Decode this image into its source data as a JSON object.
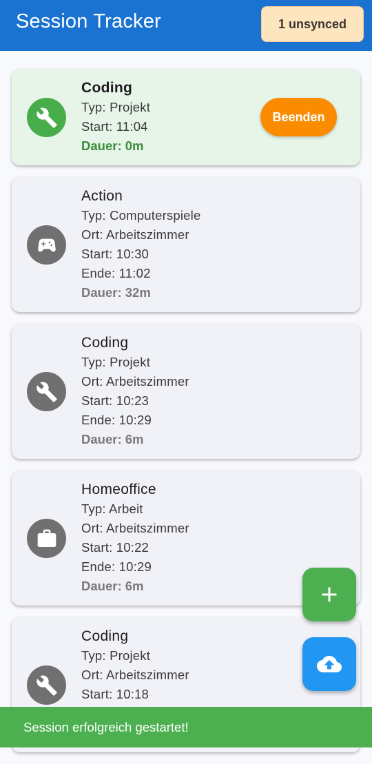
{
  "appbar": {
    "title": "Session Tracker",
    "unsynced_label": "1 unsynced"
  },
  "active_session": {
    "title": "Coding",
    "type": "Typ: Projekt",
    "start": "Start: 11:04",
    "duration": "Dauer: 0m",
    "end_button": "Beenden",
    "icon": "wrench-icon"
  },
  "sessions": [
    {
      "title": "Action",
      "type": "Typ: Computerspiele",
      "location": "Ort: Arbeitszimmer",
      "start": "Start: 10:30",
      "end": "Ende: 11:02",
      "duration": "Dauer: 32m",
      "icon": "gamepad-icon"
    },
    {
      "title": "Coding",
      "type": "Typ: Projekt",
      "location": "Ort: Arbeitszimmer",
      "start": "Start: 10:23",
      "end": "Ende: 10:29",
      "duration": "Dauer: 6m",
      "icon": "wrench-icon"
    },
    {
      "title": "Homeoffice",
      "type": "Typ: Arbeit",
      "location": "Ort: Arbeitszimmer",
      "start": "Start: 10:22",
      "end": "Ende: 10:29",
      "duration": "Dauer: 6m",
      "icon": "briefcase-icon"
    },
    {
      "title": "Coding",
      "type": "Typ: Projekt",
      "location": "Ort: Arbeitszimmer",
      "start": "Start: 10:18",
      "end": "",
      "duration": "",
      "icon": "wrench-icon"
    }
  ],
  "fabs": {
    "add_icon": "plus-icon",
    "sync_icon": "cloud-upload-icon"
  },
  "snackbar": {
    "message": "Session erfolgreich gestartet!"
  },
  "colors": {
    "appbar": "#1a73d0",
    "active_card": "#e7f4e8",
    "end_button": "#fb8c00",
    "add_fab": "#4caf50",
    "sync_fab": "#2196f3",
    "snackbar": "#4caf50"
  }
}
